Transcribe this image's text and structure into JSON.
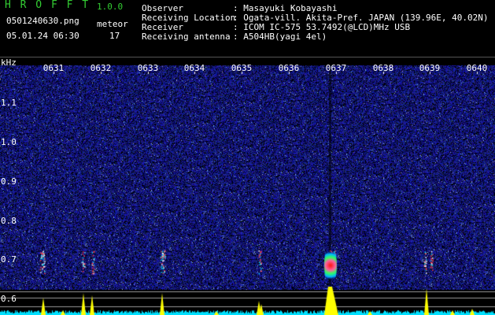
{
  "app": {
    "name": "H R O F F T",
    "version": "1.0.0"
  },
  "file": {
    "name": "0501240630.png",
    "datetime": "05.01.24 06:30"
  },
  "meteor": {
    "label": "meteor",
    "count": "17"
  },
  "info": [
    {
      "key": "Observer",
      "value": ": Masayuki Kobayashi"
    },
    {
      "key": "Receiving Location",
      "value": ": Ogata-vill. Akita-Pref. JAPAN (139.96E, 40.02N)"
    },
    {
      "key": "Receiver",
      "value": ": ICOM IC-575 53.7492(@LCD)MHz USB"
    },
    {
      "key": "Receiving antenna",
      "value": ": A504HB(yagi 4el)"
    }
  ],
  "axis": {
    "y_unit": "kHz",
    "y_ticks": [
      "1.1",
      "1.0",
      "0.9",
      "0.8",
      "0.7",
      "0.6"
    ],
    "x_ticks": [
      "0631",
      "0632",
      "0633",
      "0634",
      "0635",
      "0636",
      "0637",
      "0638",
      "0639",
      "0640"
    ]
  },
  "colors": {
    "background": "#000000",
    "title_green": "#33cc33",
    "accent_yellow": "#ffff00",
    "noise_blue": "#1a1aa0",
    "trace_cyan": "#00e0ff"
  }
}
